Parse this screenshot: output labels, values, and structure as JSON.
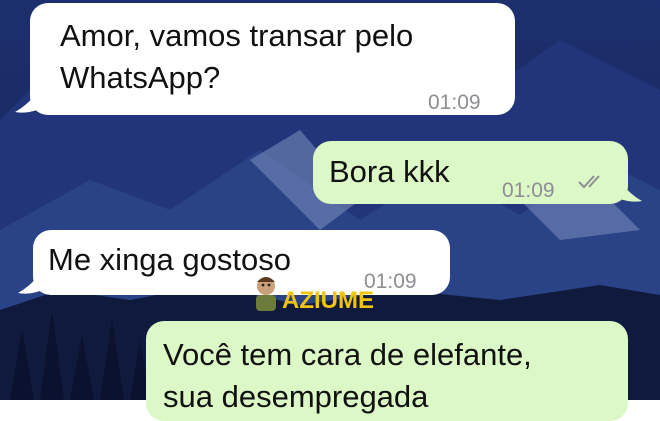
{
  "conversation": {
    "messages": [
      {
        "direction": "incoming",
        "text": "Amor, vamos transar pelo\nWhatsApp?",
        "time": "01:09"
      },
      {
        "direction": "outgoing",
        "text": "Bora kkk",
        "time": "01:09",
        "status_icon": "double-check-icon"
      },
      {
        "direction": "incoming",
        "text": "Me xinga gostoso",
        "time": "01:09"
      },
      {
        "direction": "outgoing",
        "text": "Você tem cara de elefante,\nsua desempregada",
        "time": ""
      }
    ]
  },
  "watermark": {
    "text": "AZIUME",
    "color": "#f1c40f",
    "mascot_icon": "cartoon-mascot-icon"
  },
  "colors": {
    "incoming_bubble": "#ffffff",
    "outgoing_bubble": "#dcf8c6",
    "wallpaper": "#1d2f6e",
    "timestamp": "#8e8e93"
  }
}
